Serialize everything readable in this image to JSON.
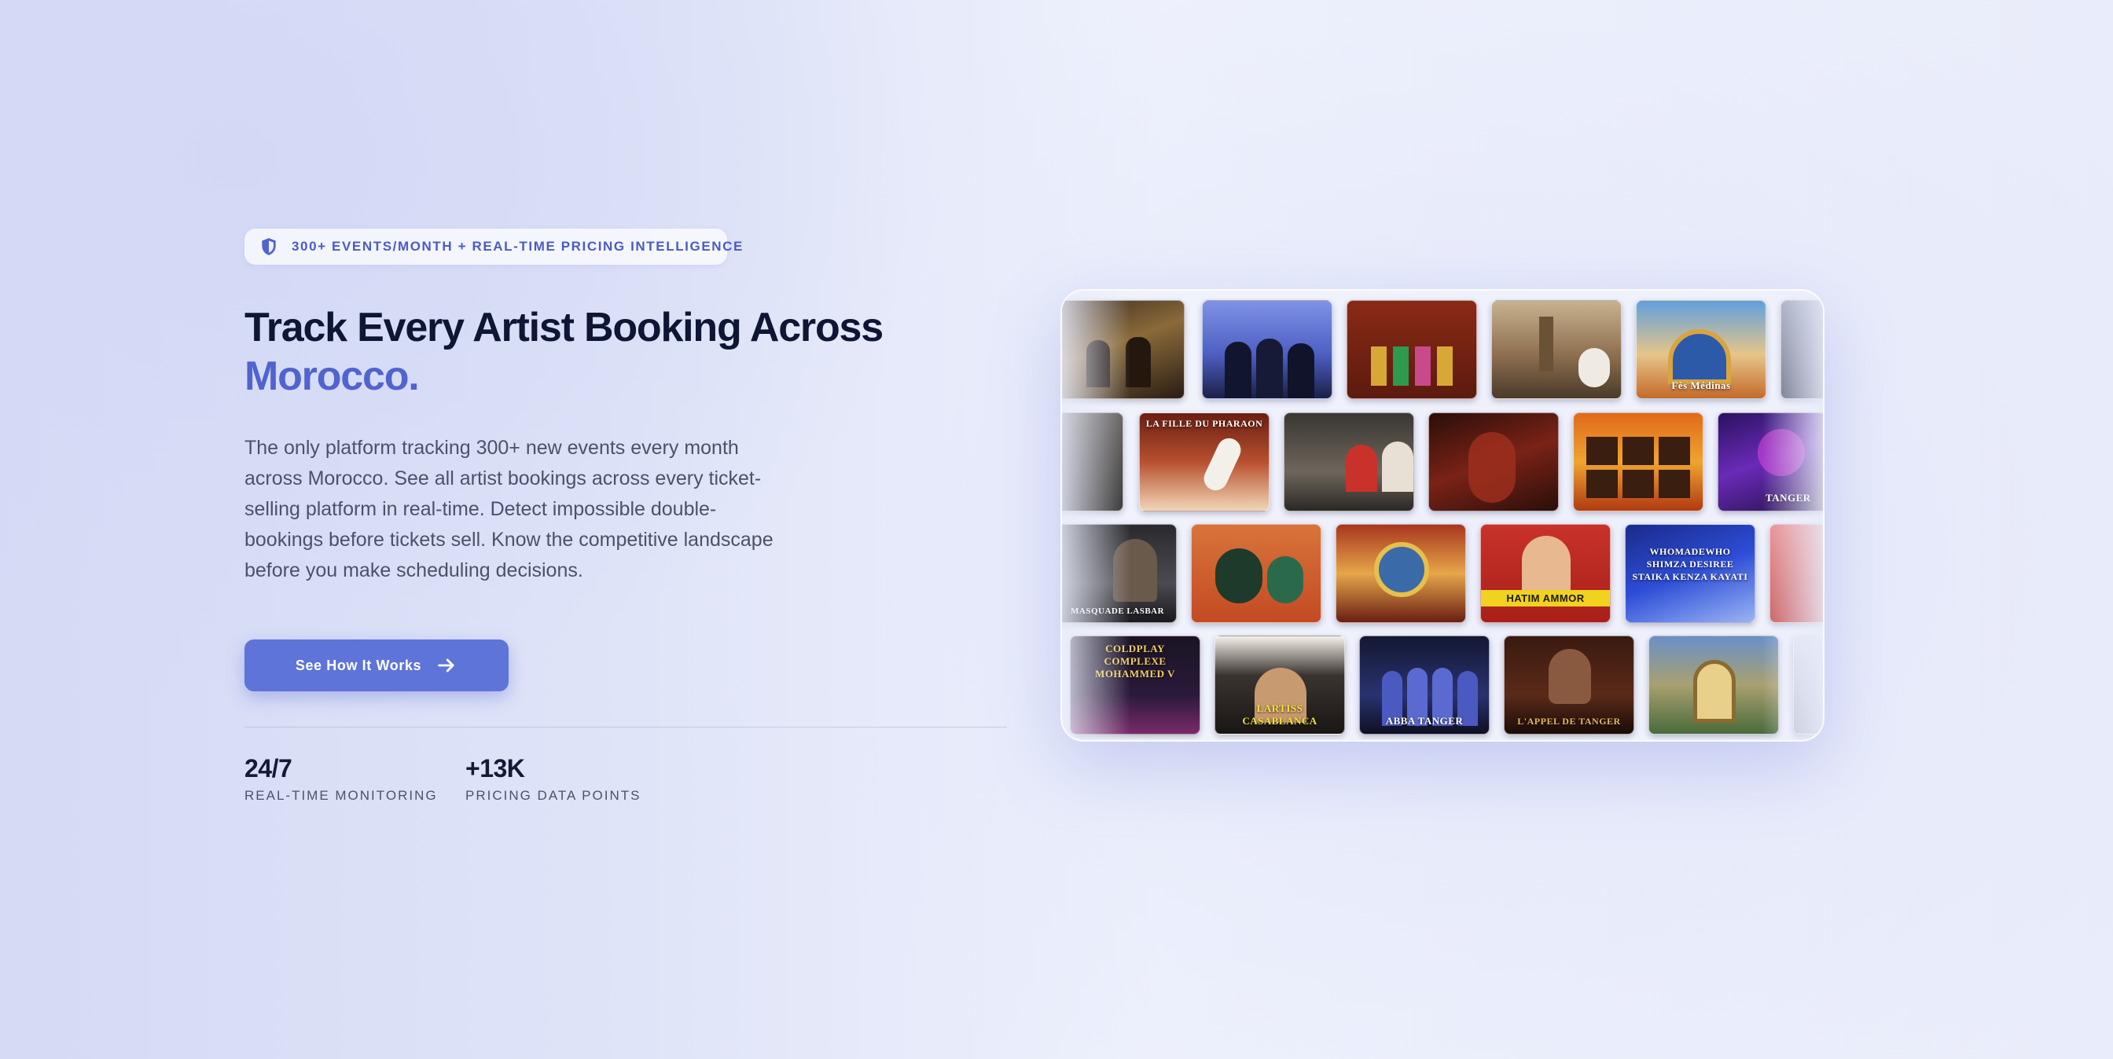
{
  "badge": {
    "icon": "shield-icon",
    "text": "300+ EVENTS/MONTH + REAL-TIME PRICING INTELLIGENCE"
  },
  "hero": {
    "headline_line1": "Track Every Artist Booking Across",
    "headline_accent": "Morocco.",
    "paragraph": "The only platform tracking 300+ new events every month across Morocco. See all artist bookings across every ticket-selling platform in real-time. Detect impossible double-bookings before tickets sell. Know the competitive landscape before you make scheduling decisions.",
    "cta_label": "See How It Works",
    "cta_icon": "arrow-right-icon"
  },
  "stats": [
    {
      "value": "24/7",
      "label": "REAL-TIME MONITORING"
    },
    {
      "value": "+13K",
      "label": "PRICING DATA POINTS"
    }
  ],
  "posters": {
    "row1": [
      "",
      "",
      "",
      "",
      "Fès Médinas",
      ""
    ],
    "row2": [
      "",
      "LA FILLE DU PHARAON",
      "",
      "",
      "",
      "TANGER"
    ],
    "row3": [
      "MASQUADE LASBAR",
      "",
      "",
      "HATIM AMMOR",
      "WHOMADEWHO SHIMZA DESIREE STAIKA KENZA KAYATI",
      ""
    ],
    "row4": [
      "COLDPLAY COMPLEXE MOHAMMED V",
      "LARTISS CASABLANCA",
      "ABBA TANGER",
      "L'APPEL DE TANGER",
      "",
      ""
    ]
  },
  "colors": {
    "accent": "#5163cf",
    "cta": "#5e74d8",
    "heading": "#0f1633"
  }
}
